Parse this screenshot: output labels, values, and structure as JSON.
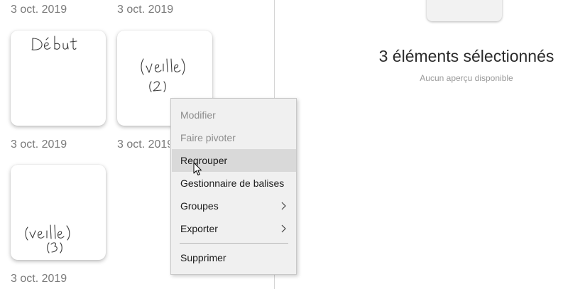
{
  "gallery": {
    "items": [
      {
        "date": "3 oct. 2019",
        "label": "Début"
      },
      {
        "date": "3 oct. 2019",
        "label": "(veille) (2)"
      },
      {
        "date": "3 oct. 2019",
        "label": "(veille) (3)"
      }
    ],
    "top_dates": [
      "3 oct. 2019",
      "3 oct. 2019"
    ]
  },
  "preview": {
    "title": "3 éléments sélectionnés",
    "subtitle": "Aucun aperçu disponible"
  },
  "context_menu": {
    "items": [
      {
        "label": "Modifier",
        "enabled": false,
        "submenu": false
      },
      {
        "label": "Faire pivoter",
        "enabled": false,
        "submenu": false
      },
      {
        "label": "Regrouper",
        "enabled": true,
        "submenu": false,
        "hovered": true
      },
      {
        "label": "Gestionnaire de balises",
        "enabled": true,
        "submenu": false
      },
      {
        "label": "Groupes",
        "enabled": true,
        "submenu": true
      },
      {
        "label": "Exporter",
        "enabled": true,
        "submenu": true
      }
    ],
    "footer_item": {
      "label": "Supprimer",
      "enabled": true
    }
  },
  "colors": {
    "menu_background": "#f0f0f0",
    "menu_hover": "#d9d9d9",
    "disabled_text": "#8d8d8d"
  },
  "icons": [
    "chevron-right-icon",
    "mouse-pointer-icon"
  ]
}
